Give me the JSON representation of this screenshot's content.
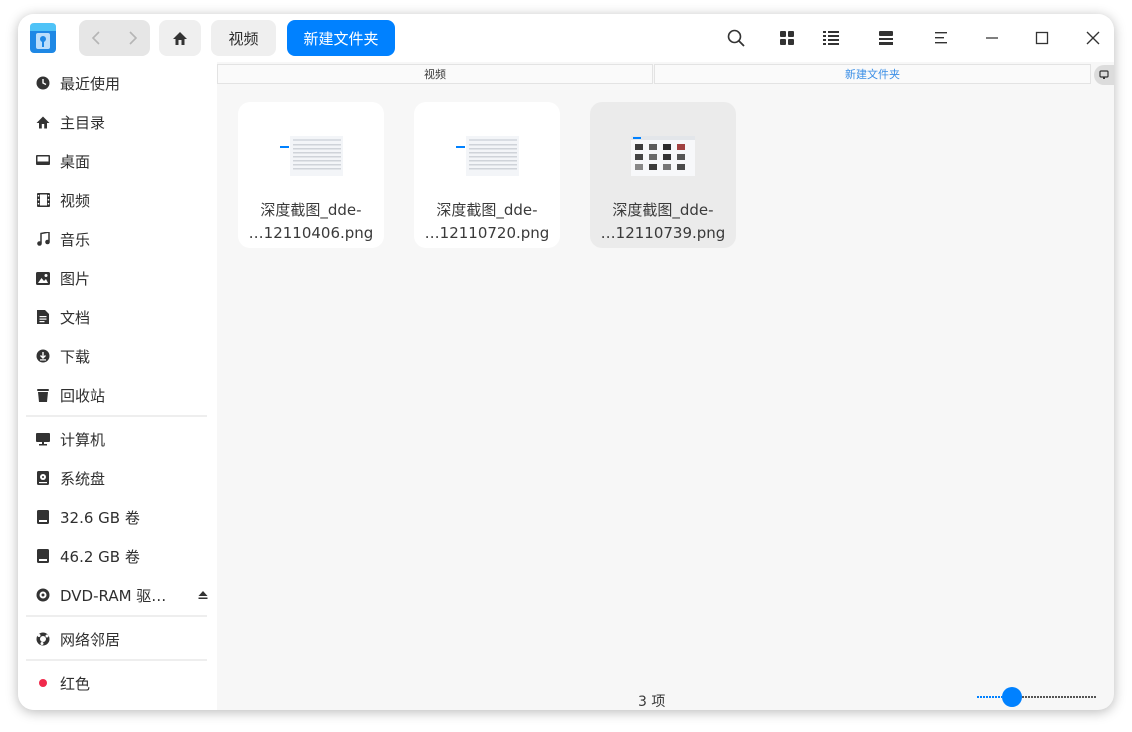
{
  "toolbar": {
    "back_icon": "chevron-left-icon",
    "forward_icon": "chevron-right-icon",
    "home_icon": "home-icon",
    "breadcrumbs": [
      "视频",
      "新建文件夹"
    ],
    "right_icons": [
      "search-icon",
      "grid-view-icon",
      "list-view-icon",
      "preview-panel-icon",
      "menu-icon",
      "minimize-icon",
      "maximize-icon",
      "close-icon"
    ]
  },
  "sidebar": {
    "items": [
      {
        "label": "最近使用",
        "icon": "clock-icon"
      },
      {
        "label": "主目录",
        "icon": "home-icon"
      },
      {
        "label": "桌面",
        "icon": "desktop-icon"
      },
      {
        "label": "视频",
        "icon": "video-icon"
      },
      {
        "label": "音乐",
        "icon": "music-icon"
      },
      {
        "label": "图片",
        "icon": "picture-icon"
      },
      {
        "label": "文档",
        "icon": "document-icon"
      },
      {
        "label": "下载",
        "icon": "download-icon"
      },
      {
        "label": "回收站",
        "icon": "trash-icon"
      }
    ],
    "devices": [
      {
        "label": "计算机",
        "icon": "computer-icon"
      },
      {
        "label": "系统盘",
        "icon": "system-disk-icon"
      },
      {
        "label": "32.6 GB 卷",
        "icon": "drive-icon"
      },
      {
        "label": "46.2 GB 卷",
        "icon": "drive-icon"
      },
      {
        "label": "DVD-RAM 驱…",
        "icon": "optical-disc-icon"
      }
    ],
    "network": [
      {
        "label": "网络邻居",
        "icon": "network-icon"
      }
    ],
    "tags": [
      {
        "label": "红色",
        "color": "#f0294b"
      }
    ]
  },
  "columns": [
    "视频",
    "新建文件夹"
  ],
  "files": [
    {
      "name_line1": "深度截图_dde-",
      "name_line2": "…12110406.png",
      "selected": false
    },
    {
      "name_line1": "深度截图_dde-",
      "name_line2": "…12110720.png",
      "selected": false
    },
    {
      "name_line1": "深度截图_dde-",
      "name_line2": "…12110739.png",
      "selected": true
    }
  ],
  "status": {
    "count": "3 项"
  },
  "colors": {
    "accent": "#0081ff",
    "tag_red": "#f0294b"
  }
}
